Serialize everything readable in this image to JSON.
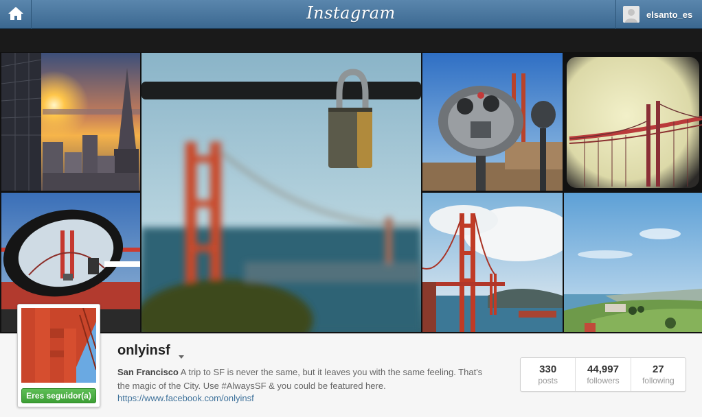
{
  "header": {
    "logo": "Instagram",
    "username": "elsanto_es",
    "home_icon": "home-icon",
    "user_icon": "user-avatar-icon"
  },
  "gallery": {
    "photos": [
      "sf-sunset-skyline",
      "padlock-golden-gate",
      "binoculars-golden-gate",
      "bridge-vintage",
      "side-mirror-bridge",
      "golden-gate-bridge-clouds",
      "park-coastline"
    ]
  },
  "profile": {
    "username": "onlyinsf",
    "follow_label": "Eres seguidor(a)",
    "bio_name": "San Francisco",
    "bio_text": " A trip to SF is never the same, but it leaves you with the same feeling. That's the magic of the City. Use #AlwaysSF & you could be featured here.",
    "link": "https://www.facebook.com/onlyinsf"
  },
  "stats": [
    {
      "value": "330",
      "label": "posts"
    },
    {
      "value": "44,997",
      "label": "followers"
    },
    {
      "value": "27",
      "label": "following"
    }
  ],
  "colors": {
    "topbar": "#4a7aa3",
    "follow_green": "#4caf44",
    "link_blue": "#3f729b"
  }
}
